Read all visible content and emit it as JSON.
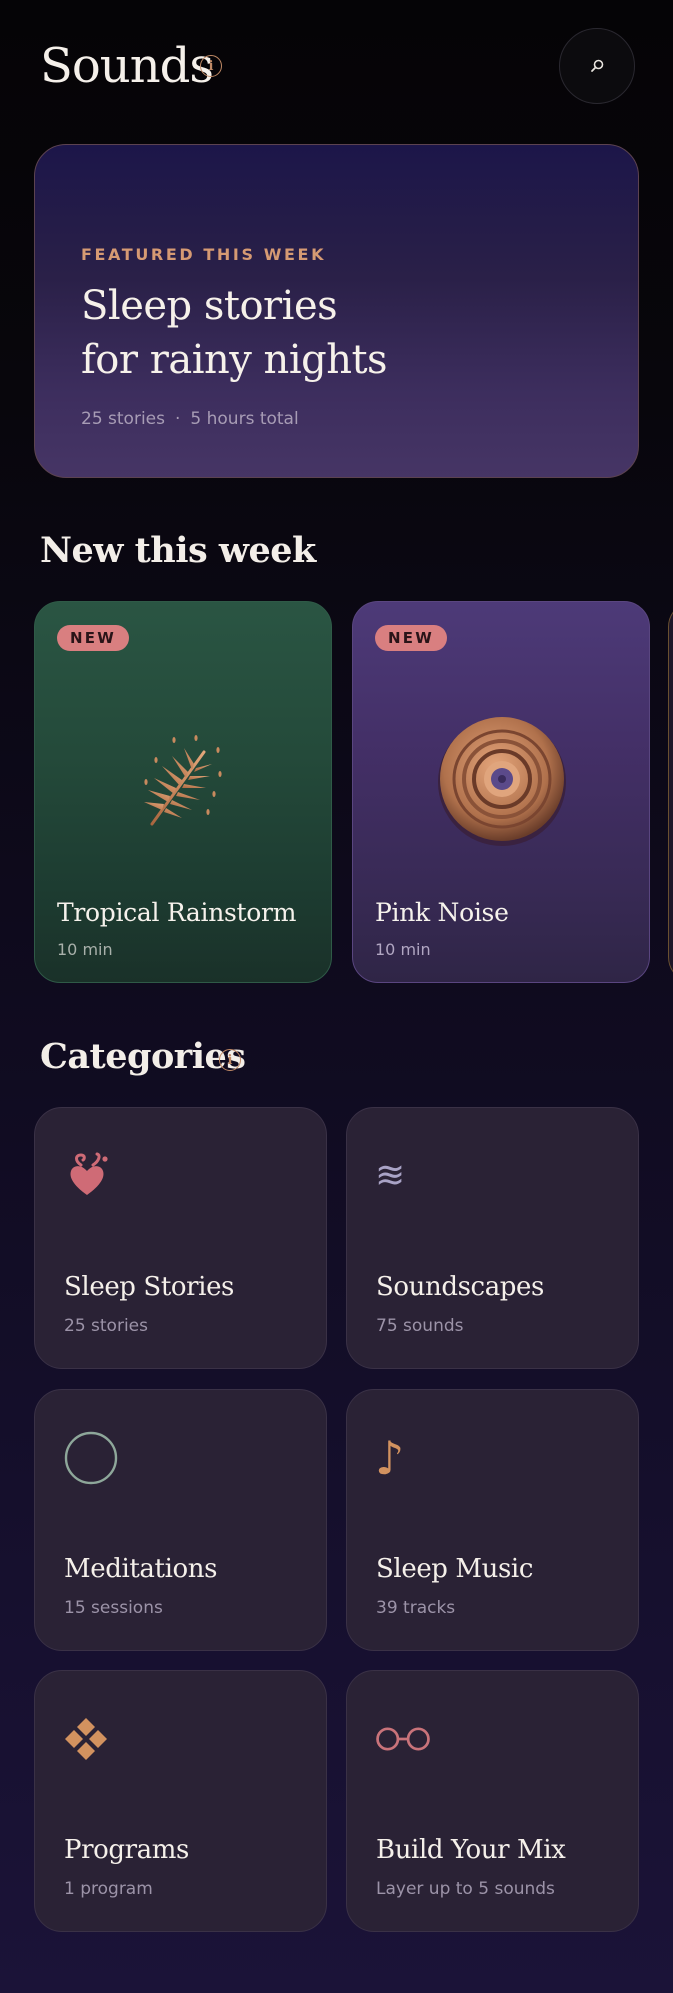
{
  "header": {
    "title": "Sounds",
    "info_glyph": "i",
    "search_icon": "search-icon"
  },
  "featured": {
    "eyebrow": "FEATURED THIS WEEK",
    "title_line1": "Sleep stories",
    "title_line2": "for rainy nights",
    "count": "25 stories",
    "separator": "·",
    "duration": "5 hours total"
  },
  "new_section": {
    "title": "New this week",
    "cards": [
      {
        "badge": "NEW",
        "title": "Tropical Rainstorm",
        "duration": "10 min",
        "icon": "palm-leaf-icon"
      },
      {
        "badge": "NEW",
        "title": "Pink Noise",
        "duration": "10 min",
        "icon": "vinyl-disc-icon"
      }
    ]
  },
  "categories": {
    "title": "Categories",
    "info_glyph": "i",
    "items": [
      {
        "name": "Sleep Stories",
        "sub": "25 stories",
        "icon": "heart-flourish-icon"
      },
      {
        "name": "Soundscapes",
        "sub": "75 sounds",
        "icon": "waves-icon",
        "glyph": "≋"
      },
      {
        "name": "Meditations",
        "sub": "15 sessions",
        "icon": "circle-icon"
      },
      {
        "name": "Sleep Music",
        "sub": "39 tracks",
        "icon": "music-note-icon",
        "glyph": "♪"
      },
      {
        "name": "Programs",
        "sub": "1 program",
        "icon": "diamonds-icon"
      },
      {
        "name": "Build Your Mix",
        "sub": "Layer up to 5 sounds",
        "icon": "glasses-icon"
      }
    ]
  },
  "colors": {
    "accent_copper": "#d69a73",
    "badge_pink": "#d97f80",
    "card_green": "#244a3a",
    "card_purple": "#432f66",
    "category_card": "#2a2235"
  }
}
